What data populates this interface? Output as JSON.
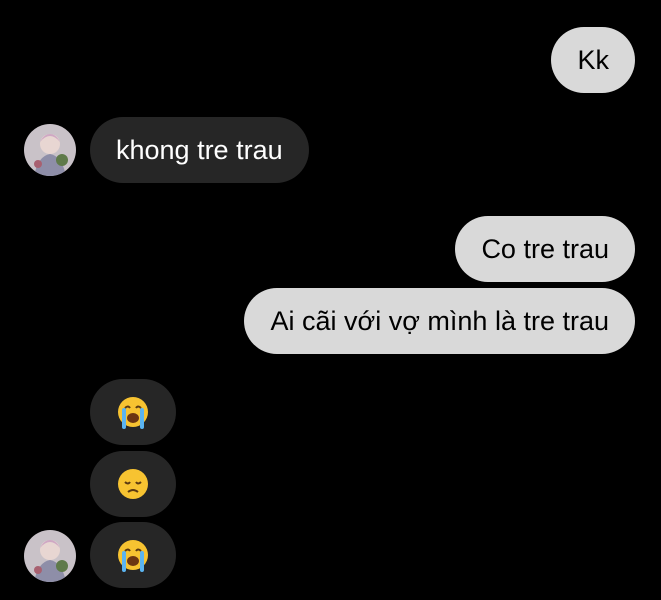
{
  "colors": {
    "background": "#000000",
    "outgoing_bubble": "#d9d9d9",
    "incoming_bubble": "#262626",
    "outgoing_text": "#000000",
    "incoming_text": "#ffffff"
  },
  "contact": {
    "avatar_icon": "profile-photo-icon"
  },
  "messages": [
    {
      "direction": "outgoing",
      "text": "Kk"
    },
    {
      "direction": "incoming",
      "text": "khong tre trau"
    },
    {
      "direction": "outgoing",
      "text": "Co tre trau"
    },
    {
      "direction": "outgoing",
      "text": "Ai cãi với vợ mình là tre trau"
    },
    {
      "direction": "incoming",
      "emoji": "loudly-crying-face-icon"
    },
    {
      "direction": "incoming",
      "emoji": "disappointed-face-icon"
    },
    {
      "direction": "incoming",
      "emoji": "loudly-crying-face-icon"
    }
  ]
}
